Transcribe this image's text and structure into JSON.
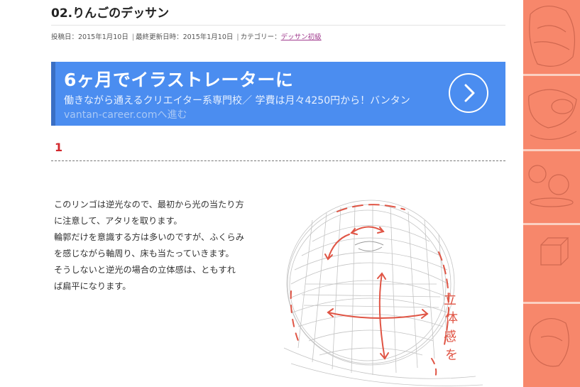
{
  "article": {
    "title": "02.りんごのデッサン",
    "meta": {
      "posted_label": "投稿日：",
      "posted_date": "2015年1月10日",
      "updated_label": "最終更新日時：",
      "updated_date": "2015年1月10日",
      "category_label": "カテゴリー：",
      "category": "デッサン初級",
      "separator": "|"
    }
  },
  "ad": {
    "headline": "6ヶ月でイラストレーターに",
    "body": "働きながら通えるクリエイター系専門校／ 学費は月々4250円から！バンタン",
    "url": "vantan-career.com",
    "url_suffix": "へ進む",
    "background_color": "#4b8df0",
    "arrow_icon": "chevron-right-icon"
  },
  "section": {
    "number": "1",
    "number_color": "#d2282d"
  },
  "body_text": [
    "このリンゴは逆光なので、最初から光の当たり方に注意して、アタリを取ります。",
    "輪郭だけを意識する方は多いのですが、ふくらみを感じながら軸周り、床も当たっていきます。",
    "そうしないと逆光の場合の立体感は、ともすれば扁平になります。"
  ],
  "sketch": {
    "annotation": "立体感を"
  },
  "sidebar": {
    "background_color": "#f7876b"
  }
}
